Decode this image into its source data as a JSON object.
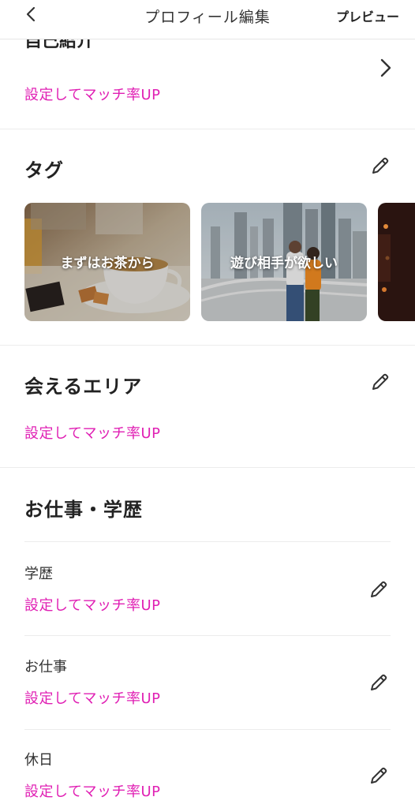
{
  "header": {
    "title": "プロフィール編集",
    "preview_label": "プレビュー"
  },
  "intro": {
    "title": "自己紹介",
    "cta": "設定してマッチ率UP"
  },
  "tags": {
    "title": "タグ",
    "items": [
      {
        "label": "まずはお茶から"
      },
      {
        "label": "遊び相手が欲しい"
      }
    ]
  },
  "area": {
    "title": "会えるエリア",
    "cta": "設定してマッチ率UP"
  },
  "work": {
    "title": "お仕事・学歴",
    "items": [
      {
        "label": "学歴",
        "cta": "設定してマッチ率UP"
      },
      {
        "label": "お仕事",
        "cta": "設定してマッチ率UP"
      },
      {
        "label": "休日",
        "cta": "設定してマッチ率UP"
      }
    ]
  },
  "colors": {
    "accent": "#e020b4",
    "text": "#222222",
    "divider": "#ececec"
  }
}
